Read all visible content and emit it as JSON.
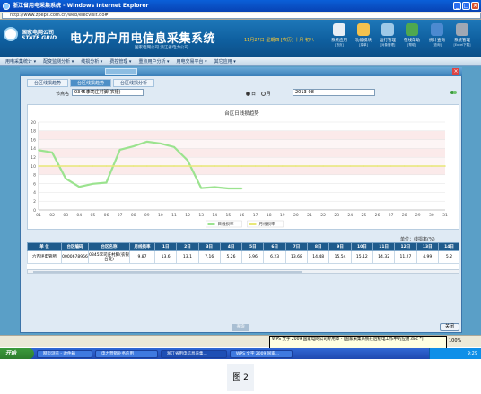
{
  "window": {
    "title": "浙江省用电采集系统 - Windows Internet Explorer",
    "buttons": [
      "_",
      "□",
      "×"
    ]
  },
  "address": {
    "url": "http://www.zpepc.com.cn/web/elecvisit.do#"
  },
  "header": {
    "logo_cn": "国家电网公司",
    "logo_en": "STATE GRID",
    "system_title": "电力用户用电信息采集系统",
    "subtitle": "国家电网公司 浙江省电力公司",
    "date_text": "11月27日 星期四 [农历] 十月 初八",
    "tools": [
      {
        "label": "系统应用",
        "sub": "[首页]",
        "icon": "home-icon",
        "color": "#e8eef5"
      },
      {
        "label": "功能模块",
        "sub": "[菜单]",
        "icon": "folder-icon",
        "color": "#f2c14e"
      },
      {
        "label": "运行管理",
        "sub": "[对象管理]",
        "icon": "gear-icon",
        "color": "#9ec9e8"
      },
      {
        "label": "在线帮助",
        "sub": "[帮助]",
        "icon": "help-icon",
        "color": "#4fa84f"
      },
      {
        "label": "统计查询",
        "sub": "[查询]",
        "icon": "chart-icon",
        "color": "#4c8ad0"
      },
      {
        "label": "系统管理",
        "sub": "[Excel下载]",
        "icon": "tools-icon",
        "color": "#a0a8b4"
      }
    ]
  },
  "menu": [
    "用电采集统计 ▾",
    "配变监测分析 ▾",
    "线损分析 ▾",
    "费控管理 ▾",
    "重点用户分析 ▾",
    "用电交易平台 ▾",
    "其它应用 ▾"
  ],
  "tabs": [
    {
      "label": "台区线损趋势",
      "active": false
    },
    {
      "label": "台区线损趋势",
      "active": true
    },
    {
      "label": "台区线损分析",
      "active": false
    }
  ],
  "form": {
    "node_label": "节点名",
    "node_value": "0345李司庄村脚(农银)",
    "radio_day": "日",
    "radio_month": "月",
    "date_value": "2013-08"
  },
  "chart_data": {
    "type": "line",
    "title": "台区日线损趋势",
    "x": [
      "01",
      "02",
      "03",
      "04",
      "05",
      "06",
      "07",
      "08",
      "09",
      "10",
      "11",
      "12",
      "13",
      "14",
      "15",
      "16",
      "17",
      "18",
      "19",
      "20",
      "21",
      "22",
      "23",
      "24",
      "25",
      "26",
      "27",
      "28",
      "29",
      "30",
      "31"
    ],
    "ylim": [
      0,
      20
    ],
    "yticks": [
      0,
      2,
      4,
      6,
      8,
      10,
      12,
      14,
      16,
      18,
      20
    ],
    "grid": true,
    "legend_position": "bottom",
    "series": [
      {
        "name": "日线损率",
        "color": "#9be38f",
        "values": [
          13.6,
          13.1,
          7.16,
          5.26,
          5.96,
          6.23,
          13.68,
          14.48,
          15.54,
          15.12,
          14.32,
          11.27,
          4.99,
          5.2,
          4.9,
          4.9
        ]
      },
      {
        "name": "月线损率",
        "color": "#e8e878",
        "values": [
          10.0,
          10.0,
          10.0,
          10.0,
          10.0,
          10.0,
          10.0,
          10.0,
          10.0,
          10.0,
          10.0,
          10.0,
          10.0,
          10.0,
          10.0,
          10.0,
          10.0,
          10.0,
          10.0,
          10.0,
          10.0,
          10.0,
          10.0,
          10.0,
          10.0,
          10.0,
          10.0,
          10.0,
          10.0,
          10.0,
          10.0
        ]
      }
    ],
    "band_colors": [
      "#fbeaea",
      "#fdf5f5"
    ]
  },
  "unit_text": "单位：线损率(%)",
  "table": {
    "headers": [
      "单 位",
      "台区编码",
      "台区名称",
      "月线损率",
      "1日",
      "2日",
      "3日",
      "4日",
      "5日",
      "6日",
      "7日",
      "8日",
      "9日",
      "10日",
      "11日",
      "12日",
      "13日",
      "14日"
    ],
    "rows": [
      [
        "六百坪电管所",
        "0000678956",
        "0345李司庄村脚(农银台变)",
        "9.87",
        "13.6",
        "13.1",
        "7.16",
        "5.26",
        "5.96",
        "6.23",
        "13.68",
        "14.48",
        "15.54",
        "15.12",
        "14.32",
        "11.27",
        "4.99",
        "5.2"
      ]
    ]
  },
  "buttons": {
    "close": "关闭",
    "gray": "查询"
  },
  "status": {
    "tooltip": "WPS 文字 2009 国家电网公司专用章 - [国家采集系统在后统电工作中的应用.doc *]",
    "zoom": "100%"
  },
  "taskbar": {
    "start": "开始",
    "items": [
      "网页浏览 - 收件箱",
      "电力营销业务应用",
      "浙江省用电信息采集...",
      "WPS 文字 2009 国家..."
    ],
    "clock": "9:29"
  },
  "caption": "图 2"
}
